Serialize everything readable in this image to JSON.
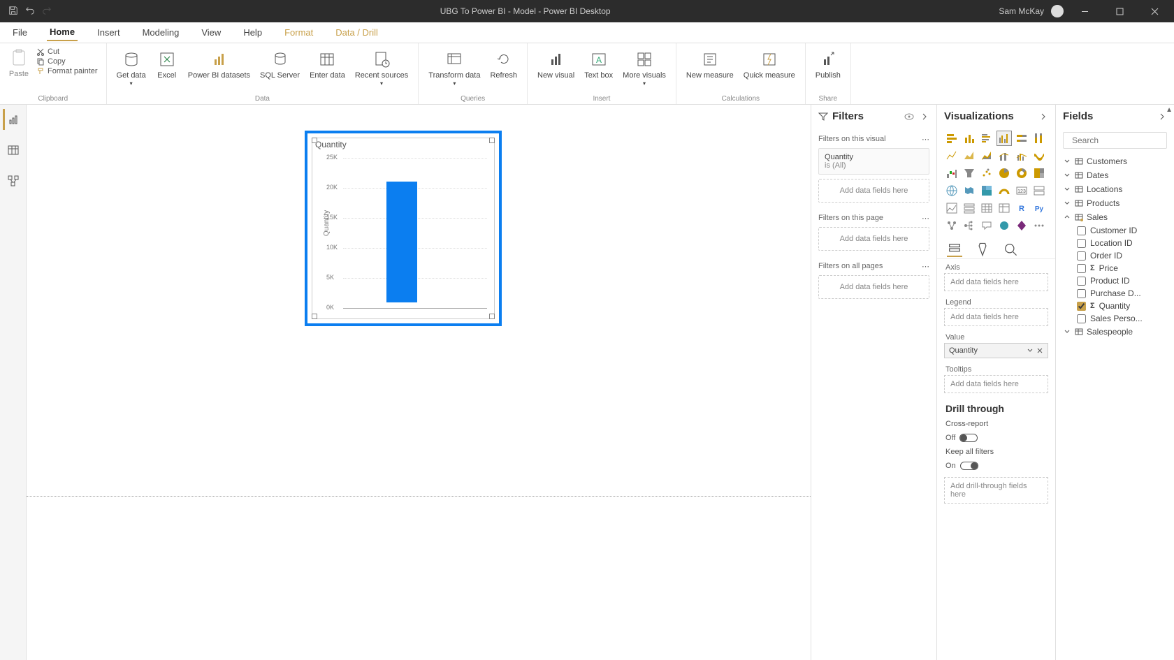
{
  "titlebar": {
    "title": "UBG To Power BI - Model - Power BI Desktop",
    "user": "Sam McKay"
  },
  "menu": {
    "file": "File",
    "home": "Home",
    "insert": "Insert",
    "modeling": "Modeling",
    "view": "View",
    "help": "Help",
    "format": "Format",
    "datadrill": "Data / Drill"
  },
  "ribbon": {
    "paste": "Paste",
    "cut": "Cut",
    "copy": "Copy",
    "format_painter": "Format painter",
    "clipboard": "Clipboard",
    "get_data": "Get data",
    "excel": "Excel",
    "pbi_datasets": "Power BI datasets",
    "sql_server": "SQL Server",
    "enter_data": "Enter data",
    "recent_sources": "Recent sources",
    "data": "Data",
    "transform_data": "Transform data",
    "refresh": "Refresh",
    "queries": "Queries",
    "new_visual": "New visual",
    "text_box": "Text box",
    "more_visuals": "More visuals",
    "insert_grp": "Insert",
    "new_measure": "New measure",
    "quick_measure": "Quick measure",
    "calculations": "Calculations",
    "publish": "Publish",
    "share": "Share"
  },
  "filters": {
    "title": "Filters",
    "on_visual": "Filters on this visual",
    "quantity": "Quantity",
    "quantity_state": "is (All)",
    "add_fields": "Add data fields here",
    "on_page": "Filters on this page",
    "on_all": "Filters on all pages"
  },
  "viz": {
    "title": "Visualizations",
    "axis": "Axis",
    "legend": "Legend",
    "value": "Value",
    "value_item": "Quantity",
    "tooltips": "Tooltips",
    "add_fields": "Add data fields here",
    "drill": "Drill through",
    "cross_report": "Cross-report",
    "off": "Off",
    "keep_filters": "Keep all filters",
    "on": "On",
    "add_drill": "Add drill-through fields here"
  },
  "fields": {
    "title": "Fields",
    "search": "Search",
    "tables": {
      "customers": "Customers",
      "dates": "Dates",
      "locations": "Locations",
      "products": "Products",
      "sales": "Sales",
      "salespeople": "Salespeople"
    },
    "sales_fields": {
      "customer_id": "Customer ID",
      "location_id": "Location ID",
      "order_id": "Order ID",
      "price": "Price",
      "product_id": "Product ID",
      "purchase_d": "Purchase D...",
      "quantity": "Quantity",
      "sales_perso": "Sales Perso..."
    }
  },
  "chart_data": {
    "type": "bar",
    "title": "Quantity",
    "ylabel": "Quantity",
    "categories": [
      ""
    ],
    "values": [
      21000
    ],
    "ylim": [
      0,
      25000
    ],
    "yticks": [
      "0K",
      "5K",
      "10K",
      "15K",
      "20K",
      "25K"
    ]
  }
}
